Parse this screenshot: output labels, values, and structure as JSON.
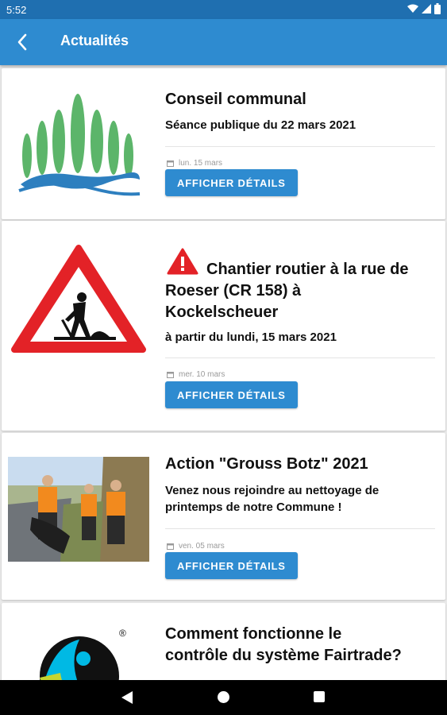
{
  "status_bar": {
    "time": "5:52"
  },
  "header": {
    "title": "Actualités"
  },
  "news": [
    {
      "title": "Conseil communal",
      "subtitle": "Séance publique du 22 mars 2021",
      "date": "lun. 15 mars",
      "button_label": "AFFICHER DÉTAILS"
    },
    {
      "title_line1": "Chantier routier à la rue de",
      "title_line2": "Roeser (CR 158) à",
      "title_line3": "Kockelscheuer",
      "subtitle": "à partir du lundi, 15 mars 2021",
      "date": "mer. 10 mars",
      "button_label": "AFFICHER DÉTAILS",
      "title_icon": "warning-icon"
    },
    {
      "title": "Action \"Grouss Botz\" 2021",
      "subtitle_line1": "Venez nous rejoindre au nettoyage de",
      "subtitle_line2": "printemps de notre Commune !",
      "date": "ven. 05 mars",
      "button_label": "AFFICHER DÉTAILS"
    },
    {
      "title_line1": "Comment fonctionne le",
      "title_line2": "contrôle du système Fairtrade?"
    }
  ],
  "colors": {
    "primary": "#2e8bd0",
    "status_bar": "#1f6fb0",
    "warning_red": "#e32227"
  }
}
